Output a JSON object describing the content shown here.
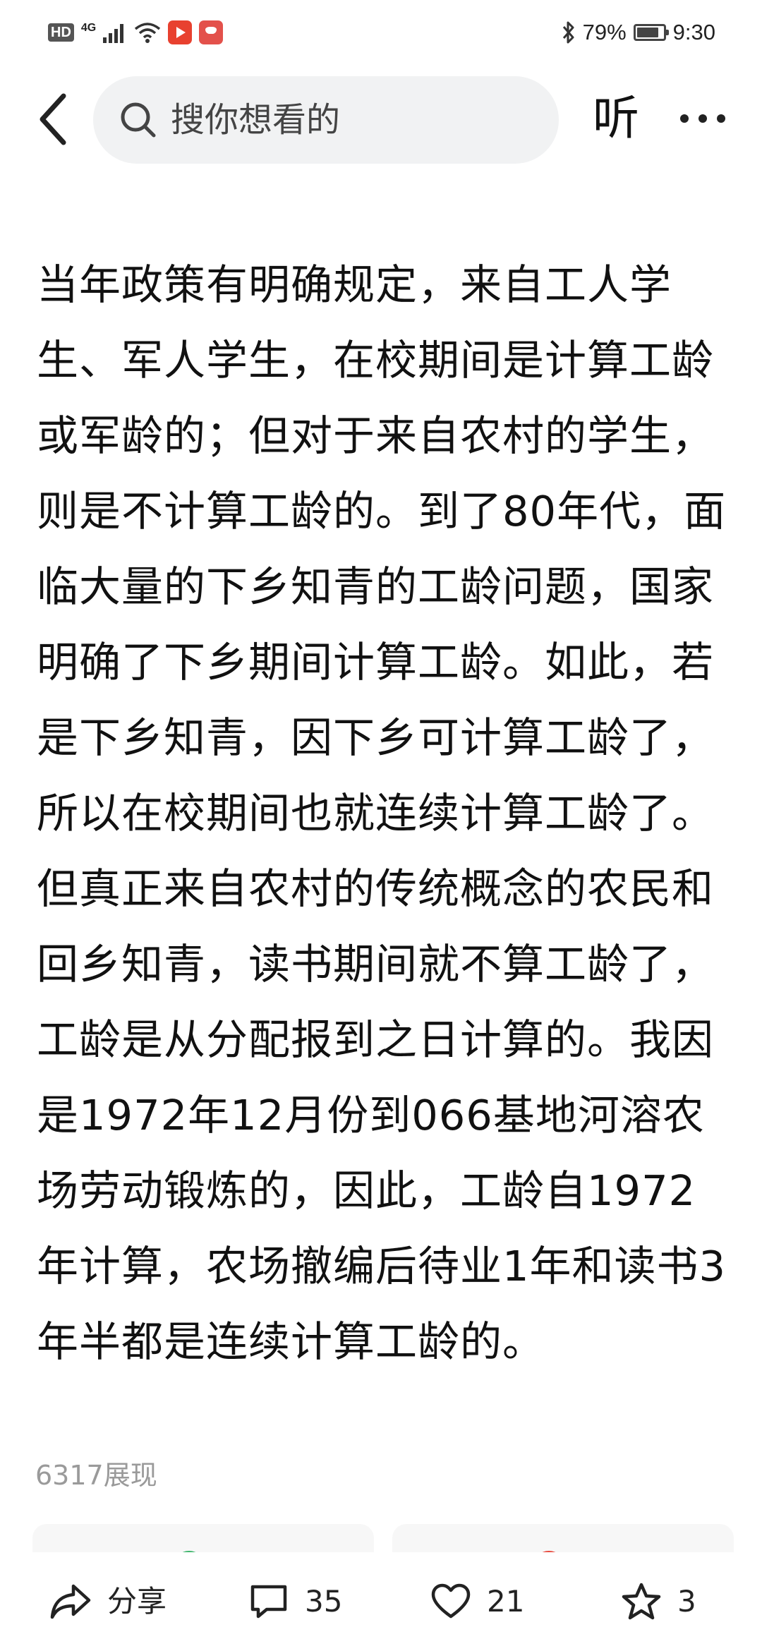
{
  "status_bar": {
    "hd": "HD",
    "network": "4G",
    "battery_percent": "79%",
    "time": "9:30"
  },
  "top_nav": {
    "search_placeholder": "搜你想看的",
    "listen_label": "听"
  },
  "article": {
    "body": "当年政策有明确规定，来自工人学生、军人学生，在校期间是计算工龄或军龄的；但对于来自农村的学生，则是不计算工龄的。到了80年代，面临大量的下乡知青的工龄问题，国家明确了下乡期间计算工龄。如此，若是下乡知青，因下乡可计算工龄了，所以在校期间也就连续计算工龄了。但真正来自农村的传统概念的农民和回乡知青，读书期间就不算工龄了，工龄是从分配报到之日计算的。我因是1972年12月份到066基地河溶农场劳动锻炼的，因此，工龄自1972年计算，农场撤编后待业1年和读书3年半都是连续计算工龄的。",
    "view_count": "6317展现"
  },
  "bottom_bar": {
    "share_label": "分享",
    "comment_count": "35",
    "like_count": "21",
    "favorite_count": "3"
  },
  "colors": {
    "search_bg": "#f1f2f3",
    "muted_text": "#9a9a9a",
    "card_dot_green": "#3bb46a",
    "card_dot_red": "#e8473b"
  }
}
